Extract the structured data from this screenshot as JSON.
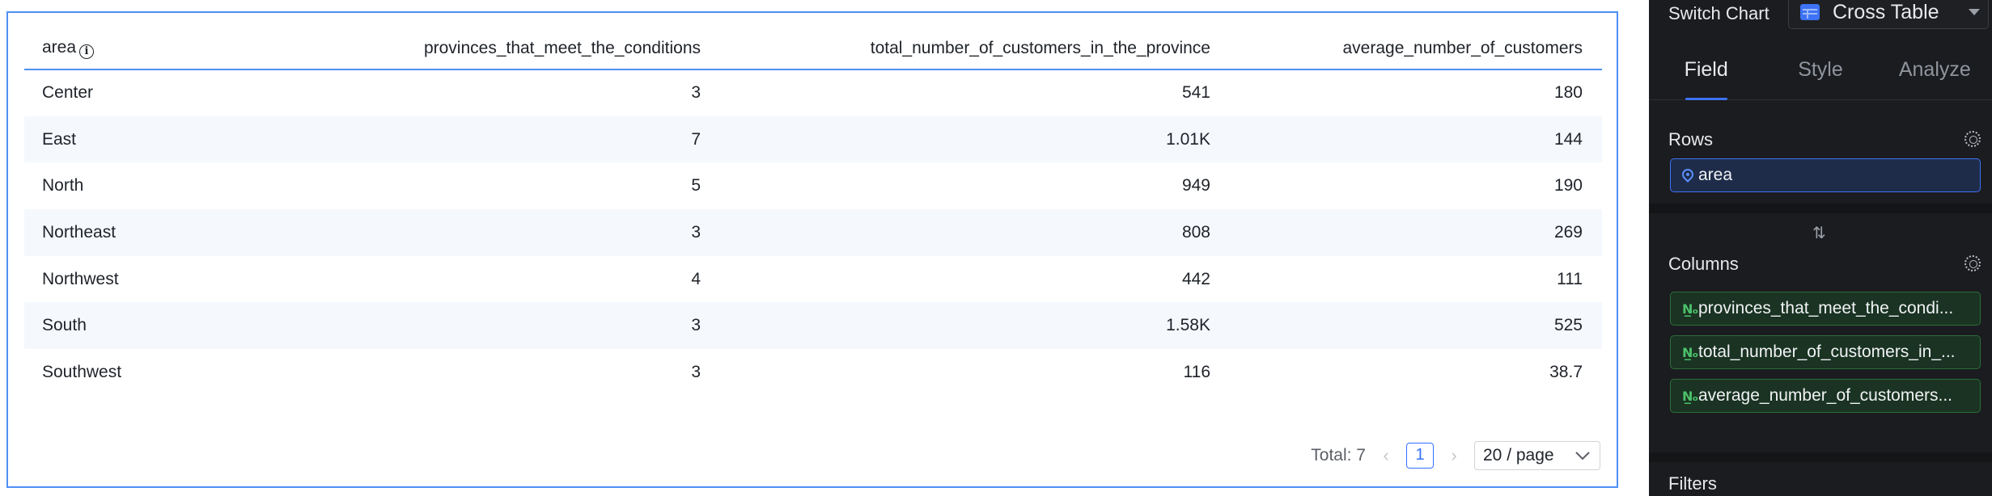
{
  "table": {
    "columns": [
      {
        "label": "area"
      },
      {
        "label": "provinces_that_meet_the_conditions"
      },
      {
        "label": "total_number_of_customers_in_the_province"
      },
      {
        "label": "average_number_of_customers"
      }
    ],
    "rows": [
      {
        "area": "Center",
        "provinces": "3",
        "total": "541",
        "average": "180"
      },
      {
        "area": "East",
        "provinces": "7",
        "total": "1.01K",
        "average": "144"
      },
      {
        "area": "North",
        "provinces": "5",
        "total": "949",
        "average": "190"
      },
      {
        "area": "Northeast",
        "provinces": "3",
        "total": "808",
        "average": "269"
      },
      {
        "area": "Northwest",
        "provinces": "4",
        "total": "442",
        "average": "111"
      },
      {
        "area": "South",
        "provinces": "3",
        "total": "1.58K",
        "average": "525"
      },
      {
        "area": "Southwest",
        "provinces": "3",
        "total": "116",
        "average": "38.7"
      }
    ],
    "row_stripe_color": "#f5f8fd",
    "header_border_color": "#4e8ff5"
  },
  "pagination": {
    "total": "Total: 7",
    "prev_icon": "chevron-left-icon",
    "current_page": "1",
    "next_icon": "chevron-right-icon",
    "page_size": "20 / page"
  },
  "sidebar": {
    "switch_chart_label": "Switch Chart",
    "chart_type": "Cross Table",
    "tabs": [
      {
        "label": "Field",
        "active": true
      },
      {
        "label": "Style",
        "active": false
      },
      {
        "label": "Analyze",
        "active": false
      }
    ],
    "rows_title": "Rows",
    "row_fields": [
      {
        "label": "area",
        "icon": "location-icon"
      }
    ],
    "columns_title": "Columns",
    "column_fields": [
      {
        "label": "provinces_that_meet_the_condi...",
        "icon": "number-icon"
      },
      {
        "label": "total_number_of_customers_in_...",
        "icon": "number-icon"
      },
      {
        "label": "average_number_of_customers...",
        "icon": "number-icon"
      }
    ],
    "filters_title": "Filters",
    "accent_color": "#3d72f4",
    "background_color": "#1b1c1f"
  }
}
